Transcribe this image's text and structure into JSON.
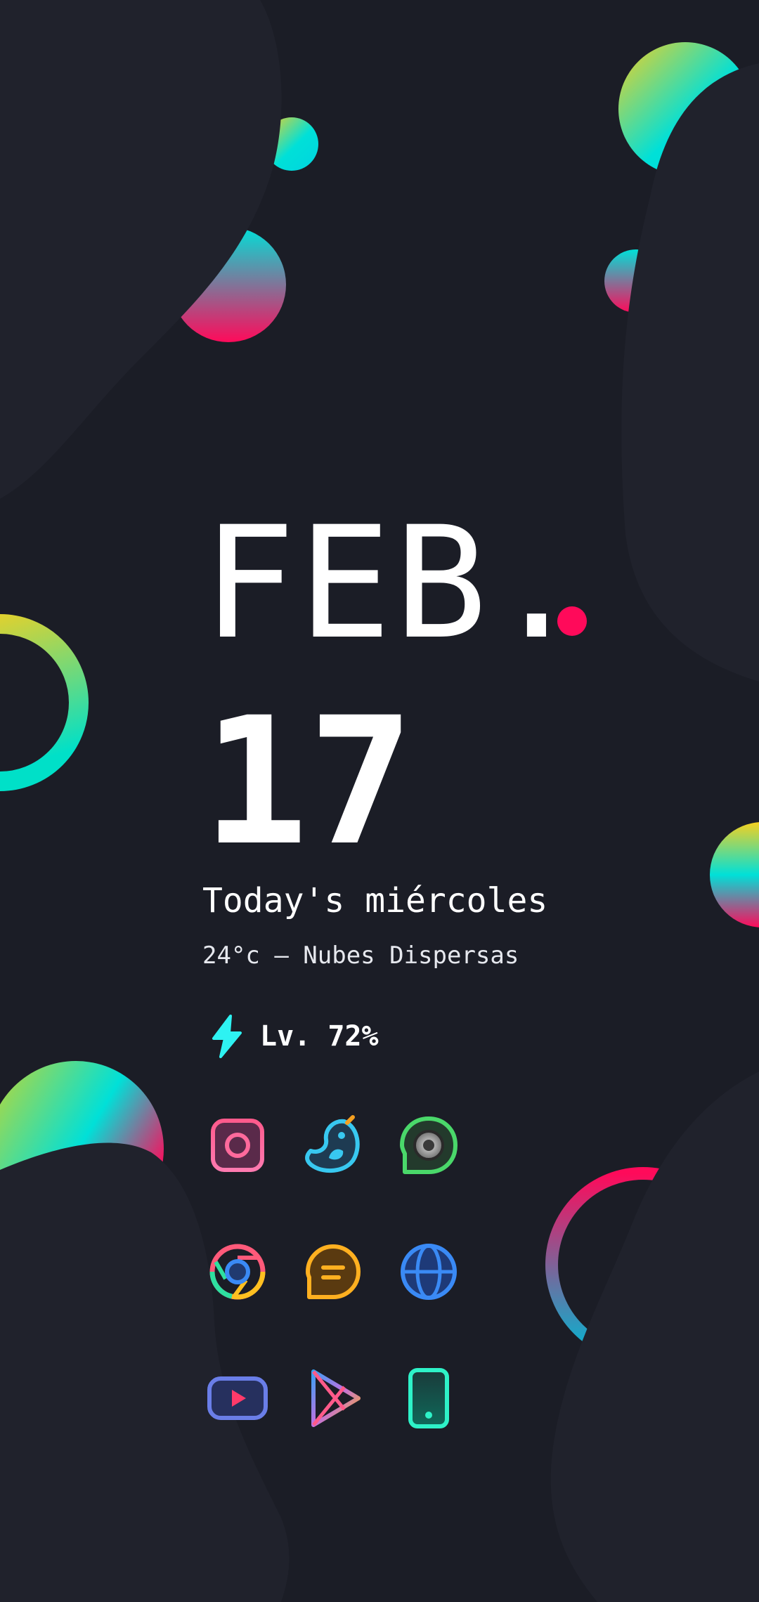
{
  "date": {
    "month": "FEB.",
    "day": "17"
  },
  "weekday_line": "Today's miércoles",
  "weather_line": "24°c – Nubes Dispersas",
  "battery": {
    "label": "Lv. 72%",
    "icon": "lightning-bolt-icon"
  },
  "accent_colors": {
    "pink": "#ff0a5a",
    "cyan": "#00e0d8",
    "yellow": "#f5d020",
    "background": "#1b1d26"
  },
  "apps": [
    {
      "icon": "instagram-icon"
    },
    {
      "icon": "bird-icon"
    },
    {
      "icon": "camera-chat-icon"
    },
    {
      "icon": "chrome-icon"
    },
    {
      "icon": "message-bubble-icon"
    },
    {
      "icon": "globe-icon"
    },
    {
      "icon": "youtube-icon"
    },
    {
      "icon": "play-store-icon"
    },
    {
      "icon": "phone-icon"
    }
  ]
}
